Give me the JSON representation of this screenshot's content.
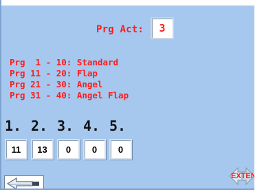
{
  "program_active": {
    "label": "Prg Act:",
    "value": "3"
  },
  "program_ranges": [
    "Prg  1 - 10: Standard",
    "Prg 11 - 20: Flap",
    "Prg 21 - 30: Angel",
    "Prg 31 - 40: Angel Flap"
  ],
  "slots": [
    {
      "header": "1.",
      "value": "11"
    },
    {
      "header": "2.",
      "value": "13"
    },
    {
      "header": "3.",
      "value": "0"
    },
    {
      "header": "4.",
      "value": "0"
    },
    {
      "header": "5.",
      "value": "0"
    }
  ],
  "footer": {
    "extend_label": "EXTEN"
  },
  "icons": {
    "back": "back-arrow-icon",
    "extend": "double-arrow-icon"
  },
  "colors": {
    "screen_background": "#a6c8ee",
    "accent_text": "#ff1b1b"
  }
}
